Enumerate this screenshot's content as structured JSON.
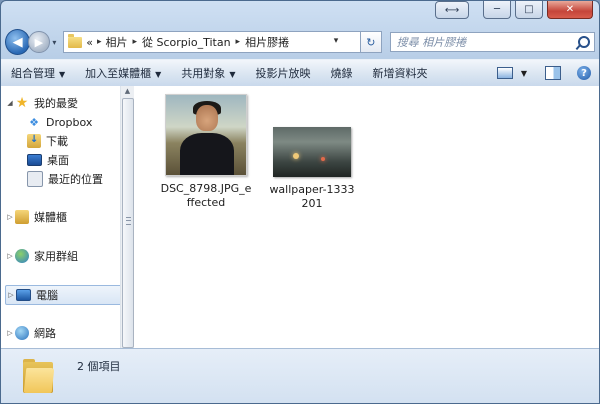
{
  "window": {
    "caption_buttons": {
      "expand": "⟷",
      "minimize": "─",
      "maximize": "□",
      "close": "✕"
    }
  },
  "nav": {
    "back_glyph": "◀",
    "forward_glyph": "▶",
    "recent_glyph": "▾",
    "breadcrumb": [
      "相片",
      "從 Scorpio_Titan",
      "相片膠捲"
    ],
    "overflow": "«",
    "separator": "▸",
    "refresh_glyph": "↻",
    "search_placeholder": "搜尋 相片膠捲"
  },
  "toolbar": {
    "organize": "組合管理",
    "add_to_library": "加入至媒體櫃",
    "share_with": "共用對象",
    "slideshow": "投影片放映",
    "burn": "燒錄",
    "new_folder": "新增資料夾",
    "help": "?"
  },
  "sidebar": {
    "favorites": "我的最愛",
    "dropbox": "Dropbox",
    "downloads": "下載",
    "desktop": "桌面",
    "recent": "最近的位置",
    "libraries": "媒體櫃",
    "homegroup": "家用群組",
    "computer": "電腦",
    "network": "網路"
  },
  "files": [
    {
      "name": "DSC_8798.JPG_effected"
    },
    {
      "name": "wallpaper-1333201"
    }
  ],
  "status": {
    "count": "2 個項目"
  },
  "colors": {
    "accent": "#3b78c4",
    "selection": "#d9e6f5",
    "toolbar": "#dae5f1"
  }
}
